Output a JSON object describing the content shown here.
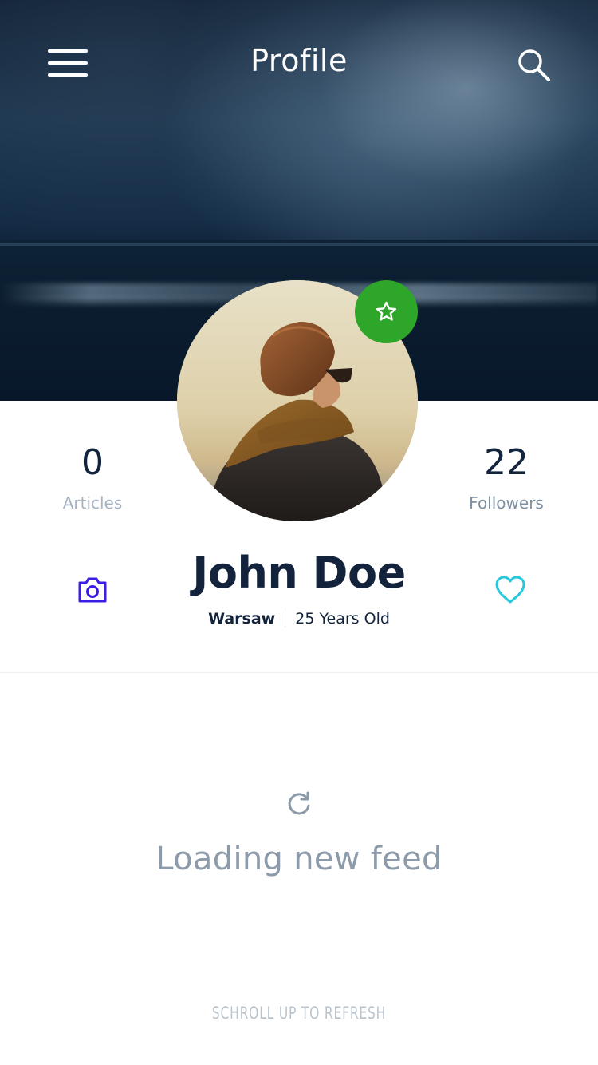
{
  "header": {
    "title": "Profile",
    "menu_icon": "hamburger-menu-icon",
    "search_icon": "search-icon"
  },
  "profile": {
    "name": "John Doe",
    "city": "Warsaw",
    "age": "25 Years Old",
    "badge_icon": "star-icon"
  },
  "stats": {
    "articles": {
      "value": "0",
      "label": "Articles"
    },
    "followers": {
      "value": "22",
      "label": "Followers"
    }
  },
  "actions": {
    "camera_icon": "camera-icon",
    "heart_icon": "heart-icon"
  },
  "feed": {
    "loading_text": "Loading new feed",
    "refresh_icon": "refresh-icon",
    "hint": "SCHROLL UP TO REFRESH"
  },
  "colors": {
    "badge_green": "#2da62a",
    "camera_blue": "#3a1ee6",
    "heart_cyan": "#28c8dc",
    "name_navy": "#12233b"
  }
}
